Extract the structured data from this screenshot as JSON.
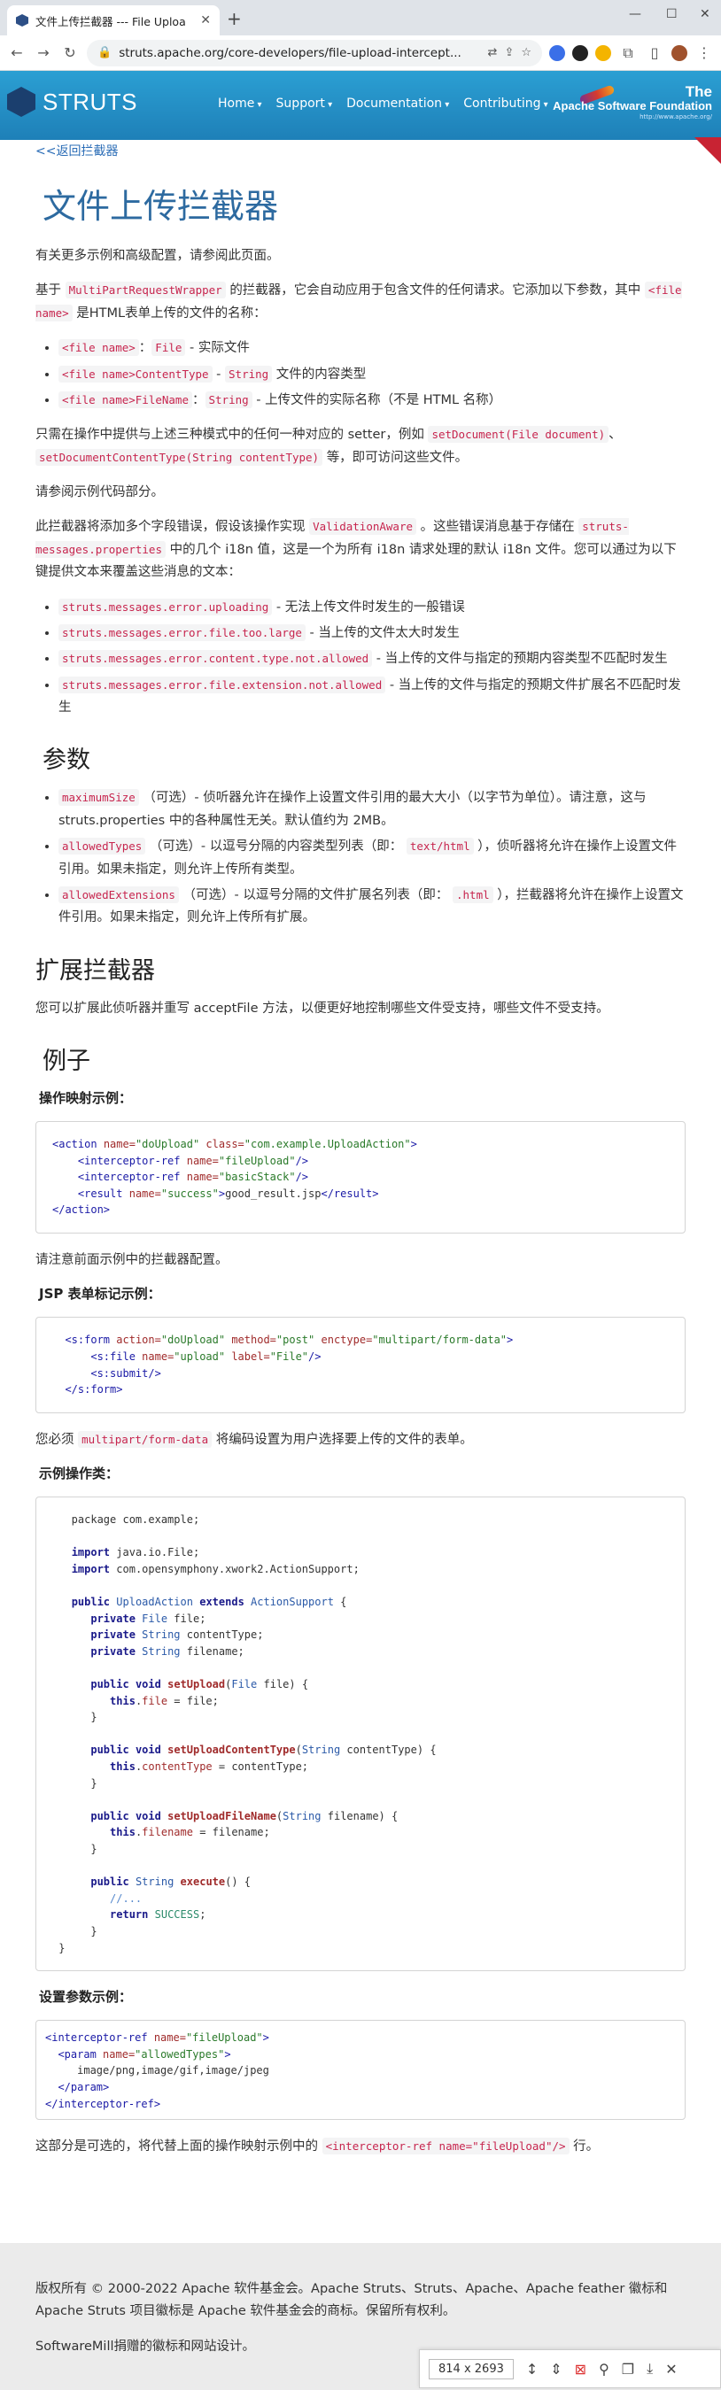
{
  "browser": {
    "tab_title": "文件上传拦截器 --- File Uploa",
    "tab_close": "✕",
    "new_tab": "+",
    "url": "struts.apache.org/core-developers/file-upload-intercept..."
  },
  "header": {
    "logo_text": "STRUTS",
    "nav": [
      "Home",
      "Support",
      "Documentation",
      "Contributing"
    ],
    "asf_the": "The",
    "asf_name": "Apache Software Foundation",
    "asf_url": "http://www.apache.org/"
  },
  "content": {
    "back_link": "<<返回拦截器",
    "title": "文件上传拦截器",
    "intro": "有关更多示例和高级配置，请参阅此页面。",
    "p1_a": "基于",
    "p1_code1": "MultiPartRequestWrapper",
    "p1_b": "的拦截器，它会自动应用于包含文件的任何请求。它添加以下参数，其中",
    "p1_code2": "<file name>",
    "p1_c": "是HTML表单上传的文件的名称：",
    "params": [
      {
        "code": "<file name>",
        "sep": "：",
        "code2": "File",
        "desc": "- 实际文件"
      },
      {
        "code": "<file name>ContentType",
        "sep": " - ",
        "code2": "String",
        "desc": "文件的内容类型"
      },
      {
        "code": "<file name>FileName",
        "sep": "：",
        "code2": "String",
        "desc": "- 上传文件的实际名称（不是 HTML 名称）"
      }
    ],
    "p2_a": "只需在操作中提供与上述三种模式中的任何一种对应的 setter，例如",
    "p2_code1": "setDocument(File document)",
    "p2_b": "、",
    "p2_code2": "setDocumentContentType(String contentType)",
    "p2_c": "等，即可访问这些文件。",
    "p3": "请参阅示例代码部分。",
    "p4_a": "此拦截器将添加多个字段错误，假设该操作实现",
    "p4_code1": "ValidationAware",
    "p4_b": "。这些错误消息基于存储在",
    "p4_code2": "struts-messages.properties",
    "p4_c": "中的几个 i18n 值，这是一个为所有 i18n 请求处理的默认 i18n 文件。您可以通过为以下键提供文本来覆盖这些消息的文本：",
    "errors": [
      {
        "code": "struts.messages.error.uploading",
        "desc": " - 无法上传文件时发生的一般错误"
      },
      {
        "code": "struts.messages.error.file.too.large",
        "desc": " - 当上传的文件太大时发生"
      },
      {
        "code": "struts.messages.error.content.type.not.allowed",
        "desc": " - 当上传的文件与指定的预期内容类型不匹配时发生"
      },
      {
        "code": "struts.messages.error.file.extension.not.allowed",
        "desc": " - 当上传的文件与指定的预期文件扩展名不匹配时发生"
      }
    ],
    "h_params": "参数",
    "param_list": [
      {
        "code": "maximumSize",
        "a": "（可选）- 侦听器允许在操作上设置文件引用的最大大小（以字节为单位）。请注意，这与 struts.properties 中的各种属性无关。默认值约为 2MB。",
        "code2": "",
        "b": ""
      },
      {
        "code": "allowedTypes",
        "a": "（可选）- 以逗号分隔的内容类型列表（即：",
        "code2": "text/html",
        "b": "），侦听器将允许在操作上设置文件引用。如果未指定，则允许上传所有类型。"
      },
      {
        "code": "allowedExtensions",
        "a": "（可选）- 以逗号分隔的文件扩展名列表（即：",
        "code2": ".html",
        "b": "），拦截器将允许在操作上设置文件引用。如果未指定，则允许上传所有扩展。"
      }
    ],
    "h_extend": "扩展拦截器",
    "extend_text": "您可以扩展此侦听器并重写 acceptFile 方法，以便更好地控制哪些文件受支持，哪些文件不受支持。",
    "h_example": "例子",
    "label_action": "操作映射示例：",
    "note_interceptor": "请注意前面示例中的拦截器配置。",
    "label_jsp": "JSP 表单标记示例：",
    "enctype_a": "您必须",
    "enctype_code": "multipart/form-data",
    "enctype_b": "将编码设置为用户选择要上传的文件的表单。",
    "label_class": "示例操作类：",
    "label_params": "设置参数示例：",
    "optional_a": "这部分是可选的，将代替上面的操作映射示例中的",
    "optional_code": "<interceptor-ref name=\"fileUpload\"/>",
    "optional_b": "行。"
  },
  "footer": {
    "line1": "版权所有 © 2000-2022 Apache 软件基金会。Apache Struts、Struts、Apache、Apache feather 徽标和 Apache Struts 项目徽标是 Apache 软件基金会的商标。保留所有权利。",
    "line2": "SoftwareMill捐赠的徽标和网站设计。"
  },
  "overlay": {
    "dimensions": "814 x 2693"
  }
}
